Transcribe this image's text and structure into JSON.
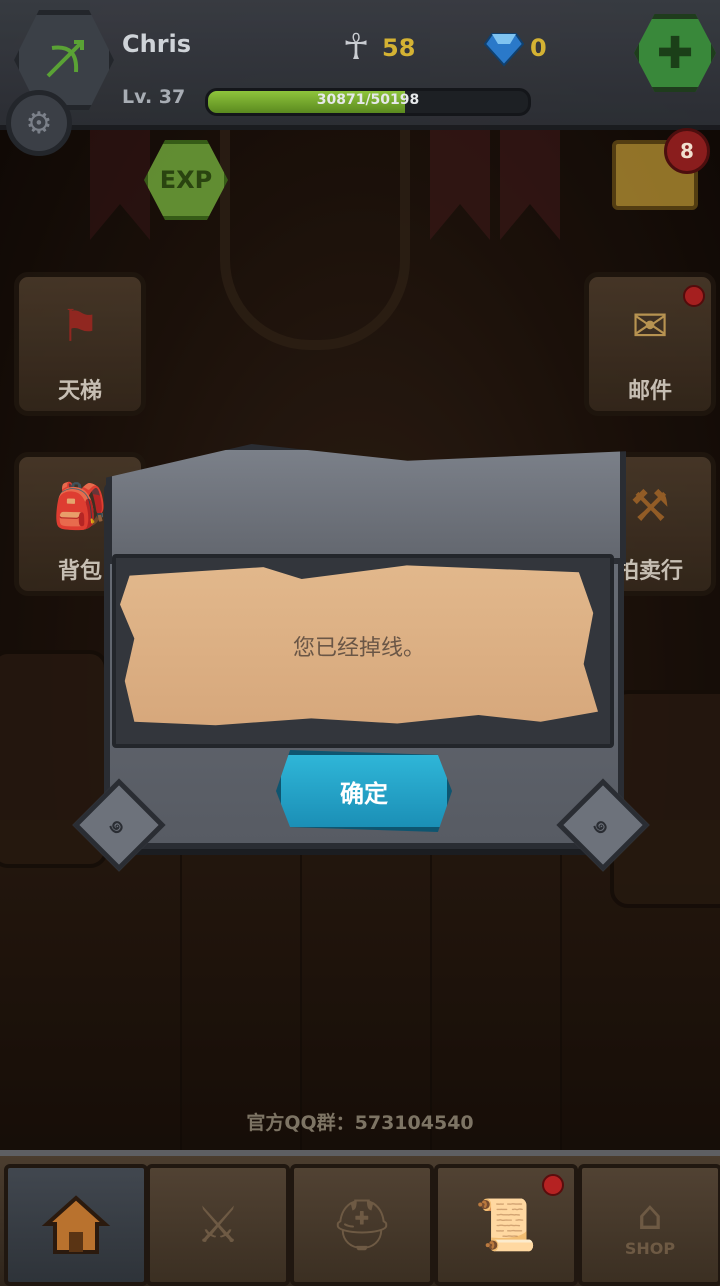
{
  "player": {
    "name": "Chris",
    "level_label": "Lv. 37",
    "xp_text": "30871/50198",
    "xp_fraction": 0.615
  },
  "currencies": {
    "ankh_value": "58",
    "gem_value": "0"
  },
  "exp_badge": "EXP",
  "chest_badge_count": "8",
  "side_buttons": {
    "ladder": "天梯",
    "mail": "邮件",
    "backpack": "背包",
    "auction": "拍卖行"
  },
  "qq_group": "官方QQ群：573104540",
  "bottom_nav": {
    "shop_label": "SHOP"
  },
  "dialog": {
    "message": "您已经掉线。",
    "confirm_label": "确定"
  },
  "colors": {
    "confirm_button": "#1b8fb6",
    "xp_fill": "#8ec43c",
    "currency_text": "#d4b233",
    "badge_red": "#8a1d1d"
  }
}
